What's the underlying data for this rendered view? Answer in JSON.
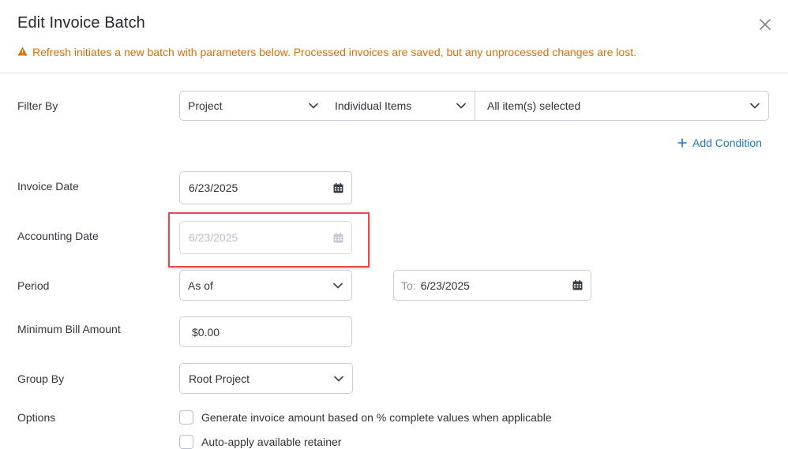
{
  "dialog": {
    "title": "Edit Invoice Batch",
    "warning": "Refresh initiates a new batch with parameters below. Processed invoices are saved, but any unprocessed changes are lost.",
    "colors": {
      "warning": "#d9700a",
      "accent": "#1e78c8",
      "highlight": "#e5484d"
    }
  },
  "filter": {
    "label": "Filter By",
    "field": "Project",
    "mode": "Individual Items",
    "items": "All item(s) selected",
    "add_condition": "Add Condition"
  },
  "invoice_date": {
    "label": "Invoice Date",
    "value": "6/23/2025"
  },
  "accounting_date": {
    "label": "Accounting Date",
    "value": "6/23/2025",
    "disabled": true
  },
  "period": {
    "label": "Period",
    "value": "As of",
    "to_prefix": "To:",
    "to_value": "6/23/2025"
  },
  "minimum_bill": {
    "label": "Minimum Bill Amount",
    "value": "$0.00"
  },
  "group_by": {
    "label": "Group By",
    "value": "Root Project"
  },
  "options": {
    "label": "Options",
    "items": [
      {
        "label": "Generate invoice amount based on % complete values when applicable",
        "checked": false
      },
      {
        "label": "Auto-apply available retainer",
        "checked": false
      }
    ]
  },
  "icons": [
    "close-icon",
    "warning-icon",
    "chevron-down-icon",
    "calendar-icon",
    "plus-icon"
  ]
}
